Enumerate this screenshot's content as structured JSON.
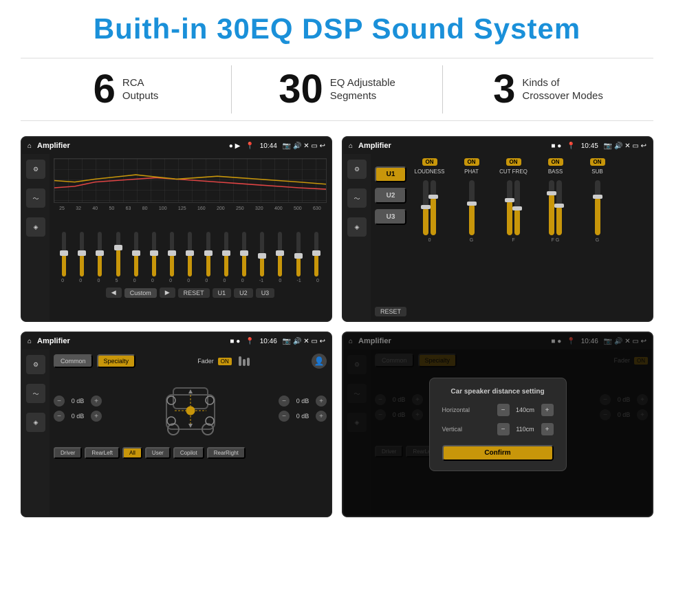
{
  "page": {
    "title": "Buith-in 30EQ DSP Sound System",
    "stats": [
      {
        "number": "6",
        "label": "RCA\nOutputs"
      },
      {
        "number": "30",
        "label": "EQ Adjustable\nSegments"
      },
      {
        "number": "3",
        "label": "Kinds of\nCrossover Modes"
      }
    ],
    "screens": [
      {
        "id": "eq-screen",
        "statusbar": {
          "home": "⌂",
          "title": "Amplifier",
          "dots": "● ▶",
          "pin": "📍",
          "time": "10:44",
          "icons": "📷 🔊 ✕ ▭ ↩"
        },
        "eq_freqs": [
          "25",
          "32",
          "40",
          "50",
          "63",
          "80",
          "100",
          "125",
          "160",
          "200",
          "250",
          "320",
          "400",
          "500",
          "630"
        ],
        "eq_values": [
          "0",
          "0",
          "0",
          "5",
          "0",
          "0",
          "0",
          "0",
          "0",
          "0",
          "0",
          "-1",
          "0",
          "-1"
        ],
        "eq_preset": "Custom",
        "eq_buttons": [
          "◀",
          "Custom",
          "▶",
          "RESET",
          "U1",
          "U2",
          "U3"
        ]
      },
      {
        "id": "crossover-screen",
        "statusbar": {
          "home": "⌂",
          "title": "Amplifier",
          "time": "10:45"
        },
        "u_buttons": [
          "U1",
          "U2",
          "U3"
        ],
        "channels": [
          {
            "on": true,
            "label": "LOUDNESS"
          },
          {
            "on": true,
            "label": "PHAT"
          },
          {
            "on": true,
            "label": "CUT FREQ"
          },
          {
            "on": true,
            "label": "BASS"
          },
          {
            "on": true,
            "label": "SUB"
          }
        ],
        "reset": "RESET"
      },
      {
        "id": "fader-screen",
        "statusbar": {
          "home": "⌂",
          "title": "Amplifier",
          "time": "10:46"
        },
        "tabs": [
          "Common",
          "Specialty"
        ],
        "active_tab": "Specialty",
        "fader_label": "Fader",
        "fader_on": "ON",
        "volumes": [
          {
            "label": "0 dB"
          },
          {
            "label": "0 dB"
          },
          {
            "label": "0 dB"
          },
          {
            "label": "0 dB"
          }
        ],
        "bottom_btns": [
          "Driver",
          "RearLeft",
          "All",
          "User",
          "Copilot",
          "RearRight"
        ]
      },
      {
        "id": "distance-screen",
        "statusbar": {
          "home": "⌂",
          "title": "Amplifier",
          "time": "10:46"
        },
        "dialog": {
          "title": "Car speaker distance setting",
          "horizontal_label": "Horizontal",
          "horizontal_value": "140cm",
          "vertical_label": "Vertical",
          "vertical_value": "110cm",
          "confirm_label": "Confirm"
        }
      }
    ]
  }
}
